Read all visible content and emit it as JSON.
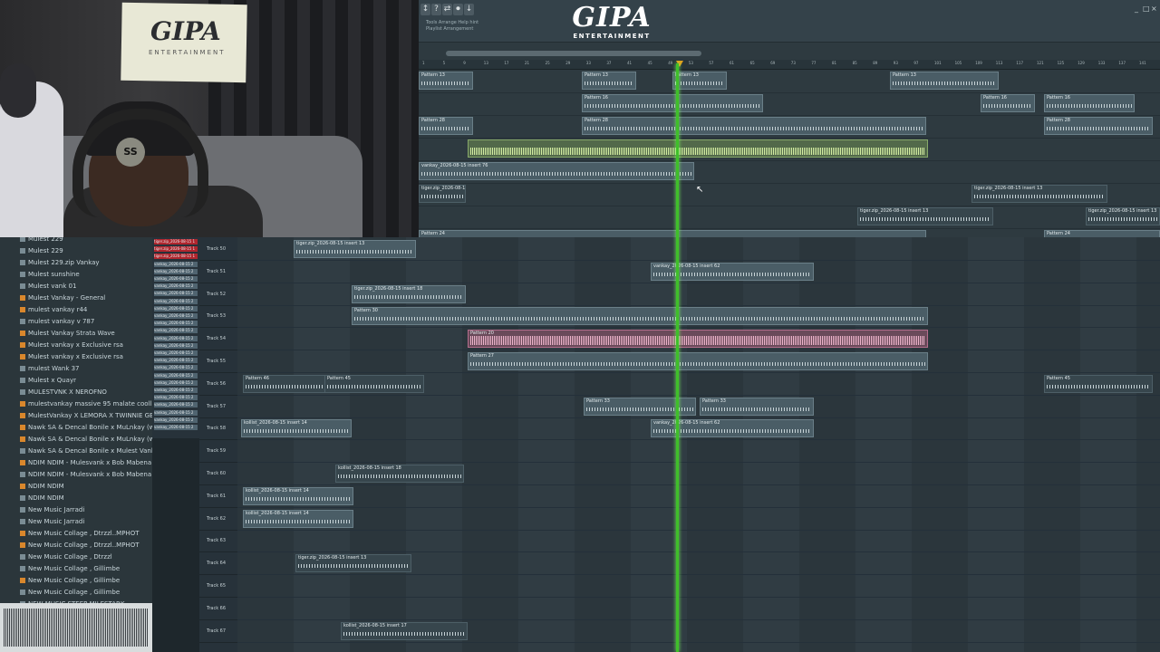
{
  "webcam": {
    "sign_text": "GIPA",
    "sign_subtext": "ENTERTAINMENT",
    "beanie_badge": "SS"
  },
  "toolbar": {
    "buttons": [
      "↕",
      "?",
      "⇄",
      "⏺",
      "↓"
    ],
    "hint_line1": "Tools  Arrange Help hint",
    "hint_line2": "Playlist  Arrangement"
  },
  "brand": {
    "logo": "GIPA",
    "sub": "ENTERTAINMENT"
  },
  "window_controls": [
    "_",
    "□",
    "×"
  ],
  "ruler": {
    "ticks": [
      "1",
      "5",
      "9",
      "13",
      "17",
      "21",
      "25",
      "29",
      "33",
      "37",
      "41",
      "45",
      "49",
      "53",
      "57",
      "61",
      "65",
      "69",
      "73",
      "77",
      "81",
      "85",
      "89",
      "93",
      "97",
      "101",
      "105",
      "109",
      "113",
      "117",
      "121",
      "125",
      "129",
      "133",
      "137",
      "141"
    ]
  },
  "browser": {
    "items": [
      {
        "label": "Mulest 229",
        "icon": "folder"
      },
      {
        "label": "Mulest 229",
        "icon": "folder"
      },
      {
        "label": "Mulest 229.zip Vankay",
        "icon": "folder"
      },
      {
        "label": "Mulest sunshine",
        "icon": "folder"
      },
      {
        "label": "Mulest vank 01",
        "icon": "folder"
      },
      {
        "label": "Mulest Vankay - General",
        "icon": "project"
      },
      {
        "label": "mulest vankay r44",
        "icon": "project"
      },
      {
        "label": "mulest vankay v 787",
        "icon": "folder"
      },
      {
        "label": "Mulest Vankay Strata Wave",
        "icon": "project"
      },
      {
        "label": "Mulest vankay x Exclusive rsa",
        "icon": "project"
      },
      {
        "label": "Mulest vankay x Exclusive rsa",
        "icon": "project"
      },
      {
        "label": "mulest Wank 37",
        "icon": "folder"
      },
      {
        "label": "Mulest x Quayr",
        "icon": "folder"
      },
      {
        "label": "MULESTVNK X NEROFNO",
        "icon": "folder"
      },
      {
        "label": "mulestvankay massive 95 malate coolll",
        "icon": "project"
      },
      {
        "label": "MulestVankay X LEMORA X TWINNIE GEE",
        "icon": "project"
      },
      {
        "label": "Nawk SA & Dencal Bonile x MuLnkay (wewolkin at 13h55)",
        "icon": "project"
      },
      {
        "label": "Nawk SA & Dencal Bonile x MuLnkay (wewolkin at 13h55)",
        "icon": "project"
      },
      {
        "label": "Nawk SA & Dencal Bonile x Mulest Vankay",
        "icon": "folder"
      },
      {
        "label": "NDIM NDIM - Mulesvank x Bob Mabena x Nimza",
        "icon": "project"
      },
      {
        "label": "NDIM NDIM - Mulesvank x Bob Mabena x Nimza",
        "icon": "folder"
      },
      {
        "label": "NDIM NDIM",
        "icon": "project"
      },
      {
        "label": "NDIM NDIM",
        "icon": "folder"
      },
      {
        "label": "New Music Jarradi",
        "icon": "folder"
      },
      {
        "label": "New Music Jarradi",
        "icon": "folder"
      },
      {
        "label": "New Music Collage , Dtrzzl..MPHOT",
        "icon": "project"
      },
      {
        "label": "New Music Collage , Dtrzzl..MPHOT",
        "icon": "project"
      },
      {
        "label": "New Music Collage , Dtrzzl",
        "icon": "folder"
      },
      {
        "label": "New Music Collage , Gillimbe",
        "icon": "folder"
      },
      {
        "label": "New Music Collage , Gillimbe",
        "icon": "project"
      },
      {
        "label": "New Music Collage , Gillimbe",
        "icon": "folder"
      },
      {
        "label": "NEW MUSIC STEEP MILESTARK",
        "icon": "folder"
      }
    ],
    "tags": [
      {
        "label": "tiger.zip_2026-08-15 1",
        "red": true
      },
      {
        "label": "tiger.zip_2026-08-15 1",
        "red": true
      },
      {
        "label": "tiger.zip_2026-08-15 1",
        "red": true
      },
      {
        "label": "vankay_2026-08-15 2",
        "red": false
      },
      {
        "label": "vankay_2026-08-15 2",
        "red": false
      },
      {
        "label": "vankay_2026-08-15 2",
        "red": false
      },
      {
        "label": "vankay_2026-08-15 2",
        "red": false
      },
      {
        "label": "vankay_2026-08-15 2",
        "red": false
      },
      {
        "label": "vankay_2026-08-15 2",
        "red": false
      },
      {
        "label": "vankay_2026-08-15 2",
        "red": false
      },
      {
        "label": "vankay_2026-08-15 2",
        "red": false
      },
      {
        "label": "vankay_2026-08-15 2",
        "red": false
      },
      {
        "label": "vankay_2026-08-15 2",
        "red": false
      },
      {
        "label": "vankay_2026-08-15 2",
        "red": false
      },
      {
        "label": "vankay_2026-08-15 2",
        "red": false
      },
      {
        "label": "vankay_2026-08-15 2",
        "red": false
      },
      {
        "label": "vankay_2026-08-15 2",
        "red": false
      },
      {
        "label": "vankay_2026-08-15 2",
        "red": false
      },
      {
        "label": "vankay_2026-08-15 2",
        "red": false
      },
      {
        "label": "vankay_2026-08-15 2",
        "red": false
      },
      {
        "label": "vankay_2026-08-15 2",
        "red": false
      },
      {
        "label": "vankay_2026-08-15 2",
        "red": false
      },
      {
        "label": "vankay_2026-08-15 2",
        "red": false
      },
      {
        "label": "vankay_2026-08-15 2",
        "red": false
      },
      {
        "label": "vankay_2026-08-15 2",
        "red": false
      },
      {
        "label": "vankay_2026-08-15 2",
        "red": false
      }
    ]
  },
  "tracks": [
    "Track 50",
    "Track 51",
    "Track 52",
    "Track 53",
    "Track 54",
    "Track 55",
    "Track 56",
    "Track 57",
    "Track 58",
    "Track 59",
    "Track 60",
    "Track 61",
    "Track 62",
    "Track 63",
    "Track 64",
    "Track 65",
    "Track 66",
    "Track 67"
  ],
  "top_rows": [
    {
      "clips": [
        {
          "label": "Pattern 13",
          "style": "normal"
        },
        {
          "label": "Pattern 13",
          "style": "normal"
        },
        {
          "label": "Pattern 13",
          "style": "normal"
        },
        {
          "label": "Pattern 13",
          "style": "normal"
        }
      ]
    },
    {
      "clips": [
        {
          "label": "Pattern 16",
          "style": "normal"
        },
        {
          "label": "Pattern 16",
          "style": "normal"
        },
        {
          "label": "Pattern 16",
          "style": "normal"
        }
      ]
    },
    {
      "clips": [
        {
          "label": "Pattern 28",
          "style": "normal"
        },
        {
          "label": "Pattern 28",
          "style": "normal"
        },
        {
          "label": "Pattern 28",
          "style": "normal"
        }
      ]
    },
    {
      "clips": [
        {
          "label": "",
          "style": "green"
        }
      ]
    },
    {
      "clips": [
        {
          "label": "vankay_2026-08-15 insert 76",
          "style": "normal"
        }
      ]
    },
    {
      "clips": [
        {
          "label": "tiger.zip_2026-08-15 insert 13",
          "style": "dim"
        },
        {
          "label": "tiger.zip_2026-08-15 insert 13",
          "style": "dim"
        }
      ]
    },
    {
      "clips": [
        {
          "label": "tiger.zip_2026-08-15 insert 13",
          "style": "dim"
        },
        {
          "label": "tiger.zip_2026-08-15 insert 13",
          "style": "dim"
        }
      ]
    },
    {
      "clips": [
        {
          "label": "Pattern 24",
          "style": "normal"
        },
        {
          "label": "Pattern 24",
          "style": "normal"
        }
      ]
    }
  ],
  "lanes": [
    {
      "clips": [
        {
          "label": "tiger.zip_2026-08-15 insert 13",
          "style": "normal"
        }
      ]
    },
    {
      "clips": [
        {
          "label": "vankay_2026-08-15 insert 62",
          "style": "normal"
        }
      ]
    },
    {
      "clips": [
        {
          "label": "tiger.zip_2026-08-15 insert 18",
          "style": "normal"
        }
      ]
    },
    {
      "clips": [
        {
          "label": "Pattern 30",
          "style": "normal"
        }
      ]
    },
    {
      "clips": [
        {
          "label": "Pattern 20",
          "style": "pink"
        }
      ]
    },
    {
      "clips": [
        {
          "label": "Pattern 27",
          "style": "normal"
        }
      ]
    },
    {
      "clips": [
        {
          "label": "Pattern 46",
          "style": "dim"
        },
        {
          "label": "Pattern 45",
          "style": "dim"
        },
        {
          "label": "Pattern 45",
          "style": "dim"
        }
      ]
    },
    {
      "clips": [
        {
          "label": "Pattern 33",
          "style": "normal"
        },
        {
          "label": "Pattern 33",
          "style": "normal"
        }
      ]
    },
    {
      "clips": [
        {
          "label": "kollist_2026-08-15 insert 14",
          "style": "normal"
        },
        {
          "label": "vankay_2026-08-15 insert 62",
          "style": "normal"
        }
      ]
    },
    {
      "clips": []
    },
    {
      "clips": [
        {
          "label": "kollist_2026-08-15 insert 18",
          "style": "dim"
        }
      ]
    },
    {
      "clips": [
        {
          "label": "kollist_2026-08-15 insert 14",
          "style": "normal"
        }
      ]
    },
    {
      "clips": [
        {
          "label": "kollist_2026-08-15 insert 14",
          "style": "normal"
        }
      ]
    },
    {
      "clips": []
    },
    {
      "clips": [
        {
          "label": "tiger.zip_2026-08-15 insert 13",
          "style": "dim"
        }
      ]
    },
    {
      "clips": []
    },
    {
      "clips": []
    },
    {
      "clips": [
        {
          "label": "kollist_2026-08-15 insert 17",
          "style": "dim"
        }
      ]
    }
  ]
}
